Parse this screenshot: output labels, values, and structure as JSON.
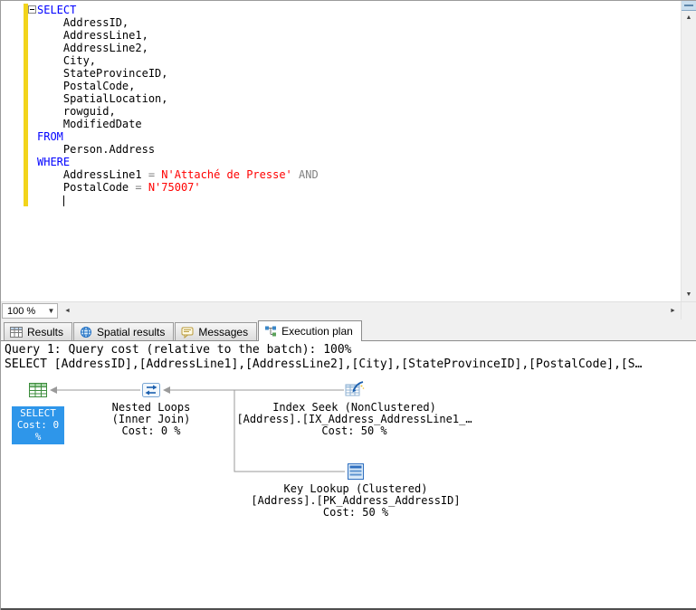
{
  "colors": {
    "keyword_blue": "#0000ff",
    "string_red": "#ff0000",
    "operator_gray": "#808080",
    "track_yellow": "#f2d41b",
    "selected_node_blue": "#2e96ea",
    "plan_edge_gray": "#9a9a9a"
  },
  "icons": {
    "scroll_up": "▲",
    "scroll_down": "▼",
    "scroll_left": "◄",
    "scroll_right": "►",
    "dropdown": "▼"
  },
  "editor": {
    "zoom_label": "100 %",
    "lines": [
      {
        "collapse": true,
        "tokens": [
          [
            "kw",
            "SELECT"
          ]
        ]
      },
      {
        "tokens": [
          [
            "id",
            "    AddressID,"
          ]
        ]
      },
      {
        "tokens": [
          [
            "id",
            "    AddressLine1,"
          ]
        ]
      },
      {
        "tokens": [
          [
            "id",
            "    AddressLine2,"
          ]
        ]
      },
      {
        "tokens": [
          [
            "id",
            "    City,"
          ]
        ]
      },
      {
        "tokens": [
          [
            "id",
            "    StateProvinceID,"
          ]
        ]
      },
      {
        "tokens": [
          [
            "id",
            "    PostalCode,"
          ]
        ]
      },
      {
        "tokens": [
          [
            "id",
            "    SpatialLocation,"
          ]
        ]
      },
      {
        "tokens": [
          [
            "id",
            "    rowguid,"
          ]
        ]
      },
      {
        "tokens": [
          [
            "id",
            "    ModifiedDate"
          ]
        ]
      },
      {
        "tokens": [
          [
            "kw",
            "FROM"
          ]
        ]
      },
      {
        "tokens": [
          [
            "id",
            "    Person.Address"
          ]
        ]
      },
      {
        "tokens": [
          [
            "kw",
            "WHERE"
          ]
        ]
      },
      {
        "tokens": [
          [
            "id",
            "    AddressLine1 "
          ],
          [
            "op",
            "= "
          ],
          [
            "str",
            "N'Attaché de Presse'"
          ],
          [
            "op",
            " AND"
          ]
        ]
      },
      {
        "tokens": [
          [
            "id",
            "    PostalCode "
          ],
          [
            "op",
            "= "
          ],
          [
            "str",
            "N'75007'"
          ]
        ]
      },
      {
        "cursor": true,
        "tokens": [
          [
            "id",
            "    "
          ]
        ]
      }
    ]
  },
  "tabs": [
    {
      "label": "Results"
    },
    {
      "label": "Spatial results"
    },
    {
      "label": "Messages"
    },
    {
      "label": "Execution plan"
    }
  ],
  "plan": {
    "header_line1": "Query 1: Query cost (relative to the batch): 100%",
    "header_line2": "SELECT [AddressID],[AddressLine1],[AddressLine2],[City],[StateProvinceID],[PostalCode],[S…",
    "nodes": {
      "select": {
        "title": "SELECT",
        "cost": "Cost: 0 %"
      },
      "nested_loops": {
        "line1": "Nested Loops",
        "line2": "(Inner Join)",
        "line3": "Cost: 0 %"
      },
      "index_seek": {
        "line1": "Index Seek (NonClustered)",
        "line2": "[Address].[IX_Address_AddressLine1_…",
        "line3": "Cost: 50 %"
      },
      "key_lookup": {
        "line1": "Key Lookup (Clustered)",
        "line2": "[Address].[PK_Address_AddressID]",
        "line3": "Cost: 50 %"
      }
    }
  }
}
